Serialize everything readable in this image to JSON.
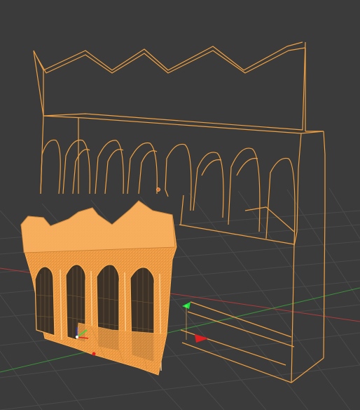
{
  "viewport": {
    "background": "#3b3b3b",
    "grid_color": "#4a4a4a",
    "grid_strong_color": "#545454",
    "axis_x_color": "#b03a3a",
    "axis_y_color": "#3a9a3a"
  },
  "objects": [
    {
      "name": "wireframe-arcade-lowpoly",
      "state": "selected",
      "color": "#f0a040"
    },
    {
      "name": "wireframe-arcade-highpoly",
      "state": "selected",
      "color": "#ffb050"
    }
  ],
  "gizmo": {
    "x_color": "#e02020",
    "y_color": "#20e040",
    "z_color": "#2040e0"
  },
  "origin_color": "#e07030"
}
